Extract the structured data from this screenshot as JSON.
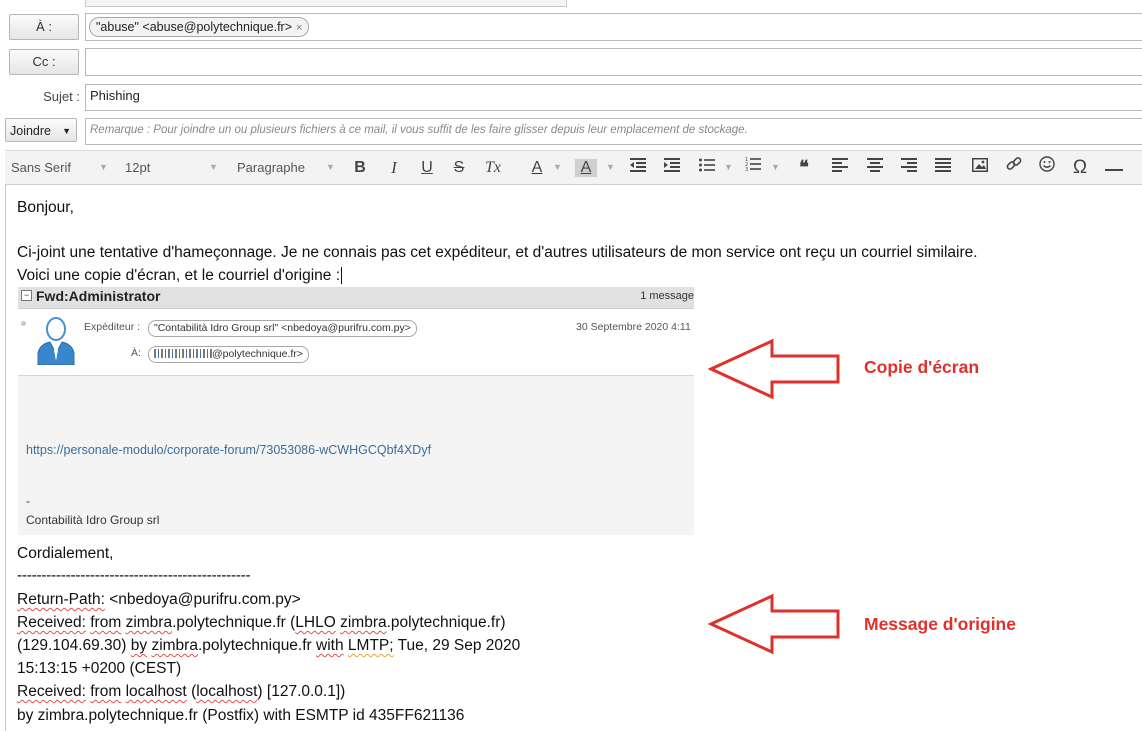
{
  "compose": {
    "to_label": "À :",
    "to_recipient": "\"abuse\" <abuse@polytechnique.fr>",
    "chip_remove": "×",
    "cc_label": "Cc :",
    "subject_label": "Sujet :",
    "subject_value": "Phishing",
    "attach_label": "Joindre",
    "attach_caret": "▼",
    "attach_note": "Remarque : Pour joindre un ou plusieurs fichiers à ce mail, il vous suffit de les faire glisser depuis leur emplacement de stockage."
  },
  "toolbar": {
    "font_family": "Sans Serif",
    "font_size": "12pt",
    "paragraph": "Paragraphe",
    "bold": "B",
    "italic": "I",
    "underline": "U",
    "strike": "S",
    "clear_format": "Tx",
    "text_color": "A",
    "highlight": "A",
    "quote": "❝"
  },
  "body": {
    "greeting": "Bonjour,",
    "line1": "Ci-joint une tentative d'hameçonnage. Je ne connais pas cet expéditeur, et d'autres utilisateurs de mon service ont reçu un courriel similaire.",
    "line2": "Voici une copie d'écran, et le courriel d'origine :",
    "closing": "Cordialement,",
    "separator": "------------------------------------------------",
    "headers": {
      "h1_a": "Return-Path:",
      "h1_b": " <nbedoya@purifru.com.py>",
      "h2_a": "Received:",
      "h2_b": "from",
      "h2_c": "zimbra",
      "h2_d": ".polytechnique.fr (",
      "h2_e": "LHLO",
      "h2_f": "zimbra",
      "h2_g": ".polytechnique.fr)",
      "h3_a": " (129.104.69.30) ",
      "h3_b": "by",
      "h3_c": "zimbra",
      "h3_d": ".polytechnique.fr ",
      "h3_e": "with",
      "h3_f": "LMTP;",
      "h3_g": " Tue, 29 Sep 2020",
      "h4": " 15:13:15 +0200 (CEST)",
      "h5_a": "Received:",
      "h5_b": "from",
      "h5_c": "localhost",
      "h5_d": "(",
      "h5_e": "localhost",
      "h5_f": " [127.0.0.1])",
      "h6": " by zimbra.polytechnique.fr (Postfix) with ESMTP id 435FF621136"
    }
  },
  "screenshot": {
    "title": "Fwd:Administrator",
    "count": "1 message",
    "sender_label": "Expéditeur :",
    "sender": "\"Contabilità Idro Group srl\" <nbedoya@purifru.com.py>",
    "date": "30 Septembre 2020 4:11",
    "to_label": "À:",
    "to_value": "@polytechnique.fr>",
    "link": "https://personale-modulo/corporate-forum/73053086-wCWHGCQbf4XDyf",
    "dash": "-",
    "signature": "Contabilità Idro Group srl"
  },
  "annotations": {
    "screenshot_label": "Copie d'écran",
    "origin_label": "Message d'origine",
    "color": "#e0302c"
  }
}
